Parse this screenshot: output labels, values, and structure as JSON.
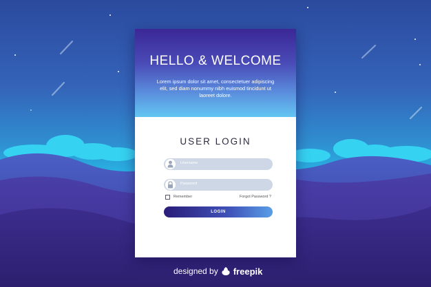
{
  "colors": {
    "card_bg": "#ffffff",
    "header_gradient_top": "#3b2796",
    "header_gradient_bottom": "#63c6f3",
    "field_bg": "#cdd7e5",
    "button_gradient_left": "#2a1c78",
    "button_gradient_right": "#5a9ee6",
    "title_text": "#2b2a3f"
  },
  "header": {
    "title": "HELLO & WELCOME",
    "description": "Lorem ipsum dolor sit amet, consectetuer adipiscing elit, sed diam nonummy nibh euismod tincidunt ut laoreet dolore."
  },
  "login": {
    "title": "USER LOGIN",
    "username_placeholder": "Username",
    "password_placeholder": "Password",
    "remember_label": "Remember",
    "forgot_label": "Forgot Password ?",
    "button_label": "LOGIN",
    "username_icon": "user-icon",
    "password_icon": "lock-icon"
  },
  "footer": {
    "prefix": "designed by",
    "brand_icon": "freepik-logo-icon",
    "brand": "freepik"
  }
}
